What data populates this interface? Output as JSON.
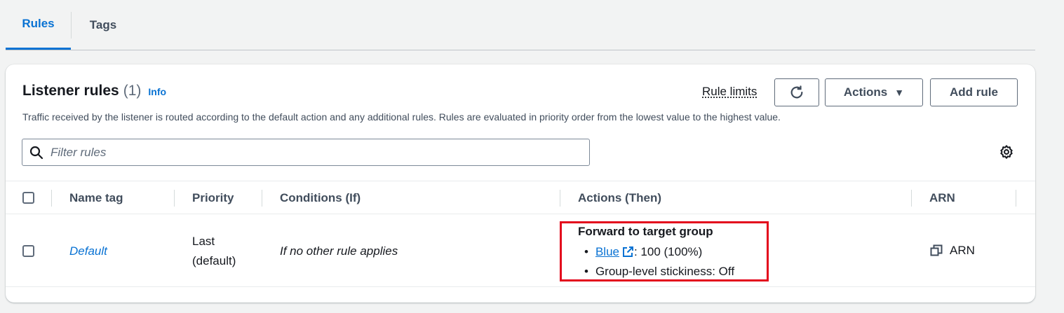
{
  "tabs": [
    {
      "label": "Rules",
      "active": true
    },
    {
      "label": "Tags",
      "active": false
    }
  ],
  "header": {
    "title": "Listener rules",
    "count": "(1)",
    "info": "Info",
    "description": "Traffic received by the listener is routed according to the default action and any additional rules. Rules are evaluated in priority order from the lowest value to the highest value."
  },
  "toolbar": {
    "rule_limits": "Rule limits",
    "actions_label": "Actions",
    "add_rule_label": "Add rule"
  },
  "search": {
    "placeholder": "Filter rules"
  },
  "table": {
    "columns": [
      "Name tag",
      "Priority",
      "Conditions (If)",
      "Actions (Then)",
      "ARN"
    ],
    "rows": [
      {
        "name_tag": "Default",
        "priority_line1": "Last",
        "priority_line2": "(default)",
        "conditions": "If no other rule applies",
        "action_title": "Forward to target group",
        "target_group": "Blue",
        "weight": ": 100 (100%)",
        "stickiness": "Group-level stickiness: Off",
        "arn": "ARN"
      }
    ]
  },
  "colors": {
    "accent": "#0972d3",
    "highlight_border": "#e3061c"
  }
}
